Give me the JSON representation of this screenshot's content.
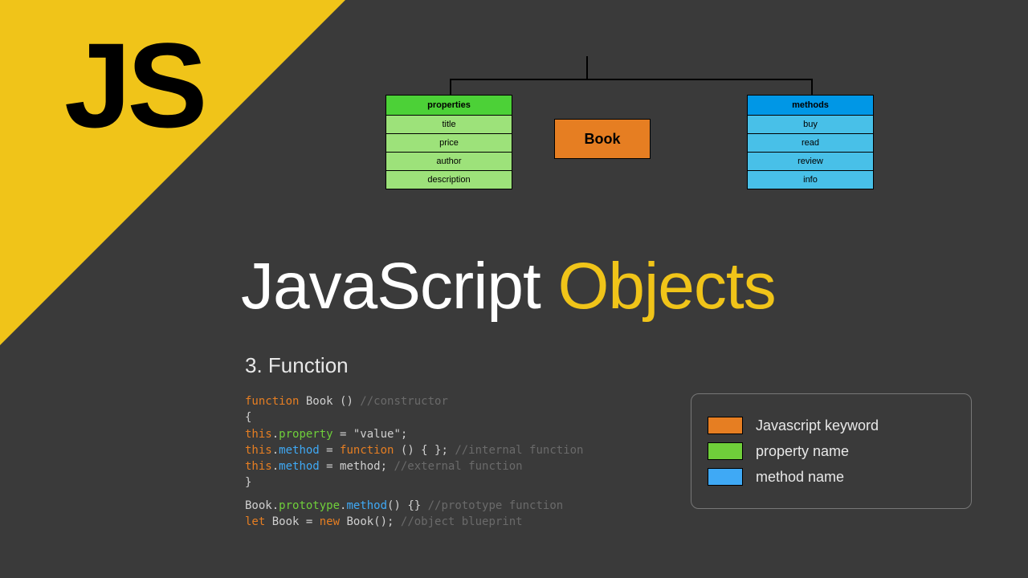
{
  "banner": {
    "logo": "JS"
  },
  "diagram": {
    "center": "Book",
    "properties": {
      "header": "properties",
      "items": [
        "title",
        "price",
        "author",
        "description"
      ]
    },
    "methods": {
      "header": "methods",
      "items": [
        "buy",
        "read",
        "review",
        "info"
      ]
    }
  },
  "title": {
    "left": "JavaScript ",
    "right": "Objects"
  },
  "subhead": "3. Function",
  "code": {
    "l1_kw": "function",
    "l1_name": " Book () ",
    "l1_cmt": "//constructor",
    "l2": "{",
    "l3_this": "  this",
    "l3_dot": ".",
    "l3_prop": "property",
    "l3_rest": " = \"value\";",
    "l4_this": "  this",
    "l4_dot": ".",
    "l4_meth": "method",
    "l4_rest": " = ",
    "l4_kw": "function",
    "l4_tail": " () { }; ",
    "l4_cmt": "//internal function",
    "l5_this": "  this",
    "l5_dot": ".",
    "l5_meth": "method",
    "l5_rest": " = method; ",
    "l5_cmt": "//external function",
    "l6": "}",
    "l7_book": "Book",
    "l7_dot1": ".",
    "l7_proto": "prototype",
    "l7_dot2": ".",
    "l7_meth": "method",
    "l7_rest": "() {} ",
    "l7_cmt": "//prototype function",
    "l8_let": "let",
    "l8_mid": " Book = ",
    "l8_new": "new",
    "l8_call": " Book(); ",
    "l8_cmt": "//object blueprint"
  },
  "legend": {
    "items": [
      {
        "color": "orange",
        "label": "Javascript keyword"
      },
      {
        "color": "green",
        "label": "property name"
      },
      {
        "color": "blue",
        "label": "method name"
      }
    ]
  }
}
